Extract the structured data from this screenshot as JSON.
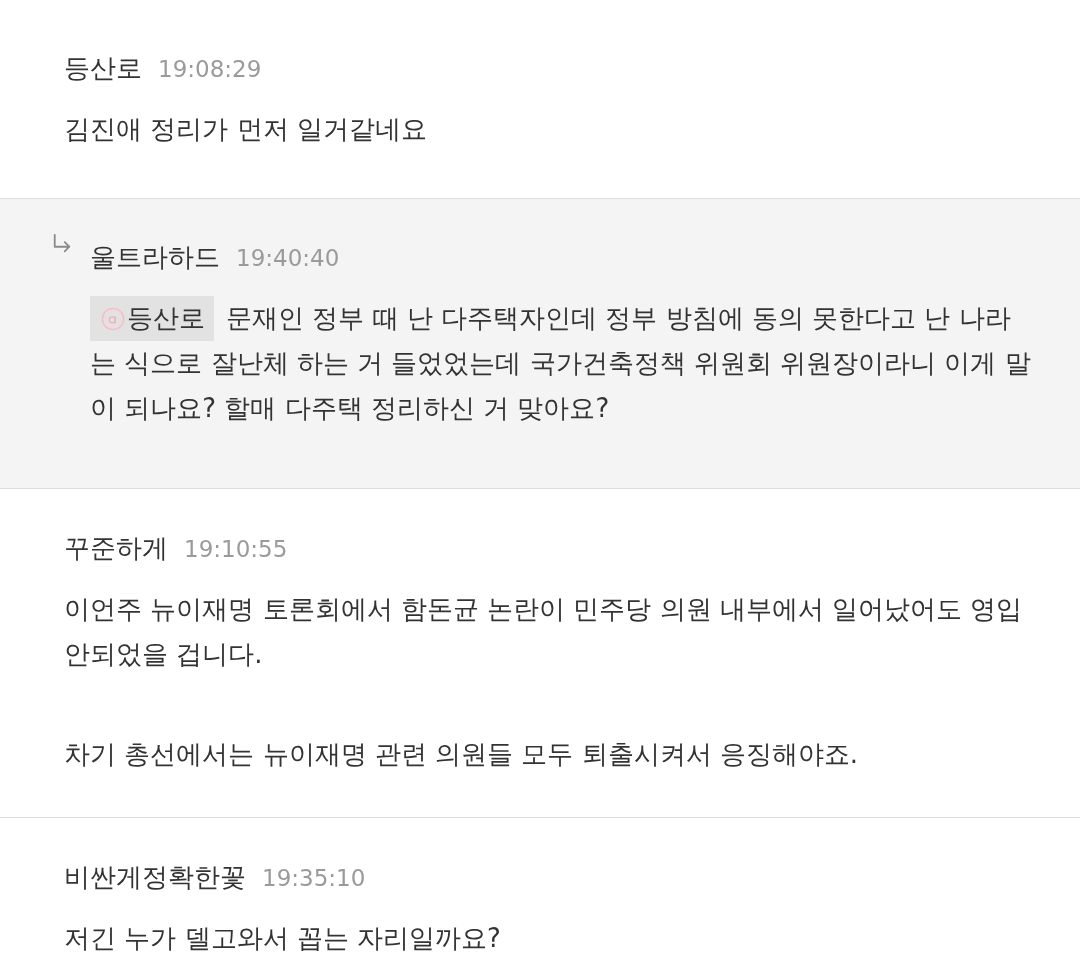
{
  "comments": [
    {
      "kind": "comment",
      "author": "등산로",
      "time": "19:08:29",
      "paragraphs": [
        "김진애 정리가 먼저 일거같네요"
      ]
    },
    {
      "kind": "reply",
      "author": "울트라하드",
      "time": "19:40:40",
      "mention": {
        "name": "등산로",
        "text": "문재인 정부 때 난 다주택자인데 정부 방침에 동의 못한다고 난 나라"
      },
      "paragraphs": [
        "는 식으로 잘난체 하는 거 들었었는데 국가건축정책 위원회 위원장이라니 이게 말이 되나요? 할매 다주택 정리하신 거 맞아요?"
      ]
    },
    {
      "kind": "comment",
      "author": "꾸준하게",
      "time": "19:10:55",
      "paragraphs": [
        "이언주 뉴이재명 토론회에서 함돈균 논란이 민주당 의원 내부에서 일어났어도 영입 안되었을 겁니다.",
        "차기 총선에서는 뉴이재명 관련 의원들 모두 퇴출시켜서 응징해야죠."
      ]
    },
    {
      "kind": "comment",
      "author": "비싼게정확한꽃",
      "time": "19:35:10",
      "paragraphs": [
        "저긴 누가 델고와서 꼽는 자리일까요?"
      ]
    }
  ]
}
